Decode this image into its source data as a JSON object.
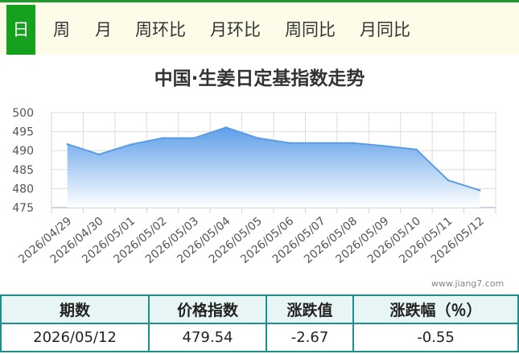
{
  "tabs": [
    {
      "label": "日",
      "active": true
    },
    {
      "label": "周"
    },
    {
      "label": "月"
    },
    {
      "label": "周环比"
    },
    {
      "label": "月环比"
    },
    {
      "label": "周同比"
    },
    {
      "label": "月同比"
    }
  ],
  "watermark": "www.jiang7.com",
  "table": {
    "headers": [
      "期数",
      "价格指数",
      "涨跌值",
      "涨跌幅（％）"
    ],
    "row": [
      "2026/05/12",
      "479.54",
      "-2.67",
      "-0.55"
    ]
  },
  "colors": {
    "accent": "#15a01e",
    "area_top": "#5d9ee8",
    "line": "#5a9be6",
    "table_border": "#1d8e8b"
  },
  "chart_data": {
    "type": "area",
    "title": "中国·生姜日定基指数走势",
    "x": [
      "2026/04/29",
      "2026/04/30",
      "2026/05/01",
      "2026/05/02",
      "2026/05/03",
      "2026/05/04",
      "2026/05/05",
      "2026/05/06",
      "2026/05/07",
      "2026/05/08",
      "2026/05/09",
      "2026/05/10",
      "2026/05/11",
      "2026/05/12"
    ],
    "values": [
      491.7,
      489.0,
      491.6,
      493.3,
      493.3,
      496.1,
      493.3,
      492.0,
      492.0,
      492.0,
      491.2,
      490.3,
      482.2,
      479.54
    ],
    "ylim": [
      475,
      500
    ],
    "yticks": [
      475,
      480,
      485,
      490,
      495,
      500
    ],
    "grid": true
  }
}
